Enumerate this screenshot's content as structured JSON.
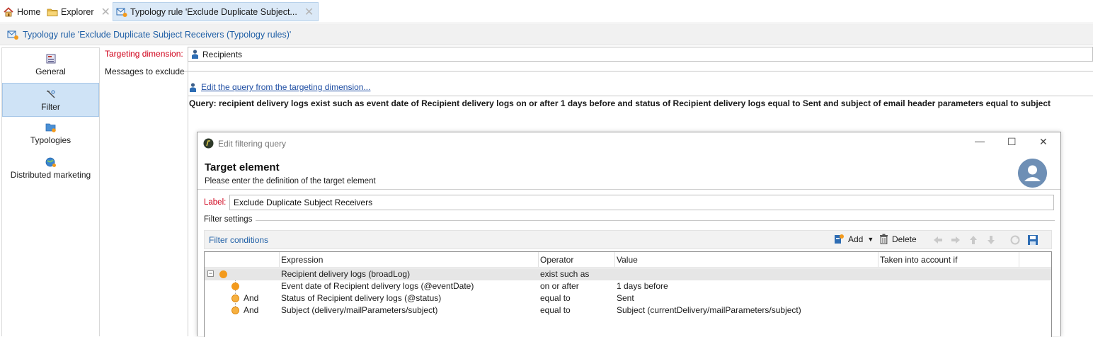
{
  "tabs": [
    {
      "label": "Home",
      "icon": "home-icon"
    },
    {
      "label": "Explorer",
      "icon": "folder-icon"
    },
    {
      "label": "Typology rule 'Exclude Duplicate Subject...",
      "icon": "typology-rule-icon",
      "active": true
    }
  ],
  "window_title": "Typology rule 'Exclude Duplicate Subject Receivers (Typology rules)'",
  "nav": [
    {
      "label": "General",
      "icon": "general-icon"
    },
    {
      "label": "Filter",
      "icon": "filter-icon",
      "selected": true
    },
    {
      "label": "Typologies",
      "icon": "typologies-icon"
    },
    {
      "label": "Distributed marketing",
      "icon": "distributed-marketing-icon"
    }
  ],
  "form": {
    "targeting_label": "Targeting dimension:",
    "targeting_value": "Recipients",
    "messages_label": "Messages to exclude",
    "edit_query_link": "Edit the query from the targeting dimension...",
    "query_text": "Query: recipient delivery logs exist such as event date of Recipient delivery logs on or after 1 days before and status of Recipient delivery logs equal to Sent and subject of email header parameters equal to subject"
  },
  "dialog": {
    "title": "Edit filtering query",
    "heading": "Target element",
    "subtitle": "Please enter the definition of the target element",
    "label_caption": "Label:",
    "label_value": "Exclude Duplicate Subject Receivers",
    "filter_settings": "Filter settings",
    "filter_conditions": "Filter conditions",
    "toolbar": {
      "add": "Add",
      "delete": "Delete"
    },
    "columns": [
      "Expression",
      "Operator",
      "Value",
      "Taken into account if"
    ],
    "rows": [
      {
        "conj": "",
        "expression": "Recipient delivery logs (broadLog)",
        "operator": "exist such as",
        "value": ""
      },
      {
        "conj": "",
        "expression": "Event date of Recipient delivery logs (@eventDate)",
        "operator": "on or after",
        "value": "1 days before"
      },
      {
        "conj": "And",
        "expression": "Status of Recipient delivery logs (@status)",
        "operator": "equal to",
        "value": "Sent"
      },
      {
        "conj": "And",
        "expression": "Subject (delivery/mailParameters/subject)",
        "operator": "equal to",
        "value": "Subject (currentDelivery/mailParameters/subject)"
      }
    ]
  },
  "colors": {
    "accent": "#1f5fa6",
    "required_label": "#d0021b",
    "selection": "#cfe3f6",
    "node_orange": "#f39a1c"
  }
}
